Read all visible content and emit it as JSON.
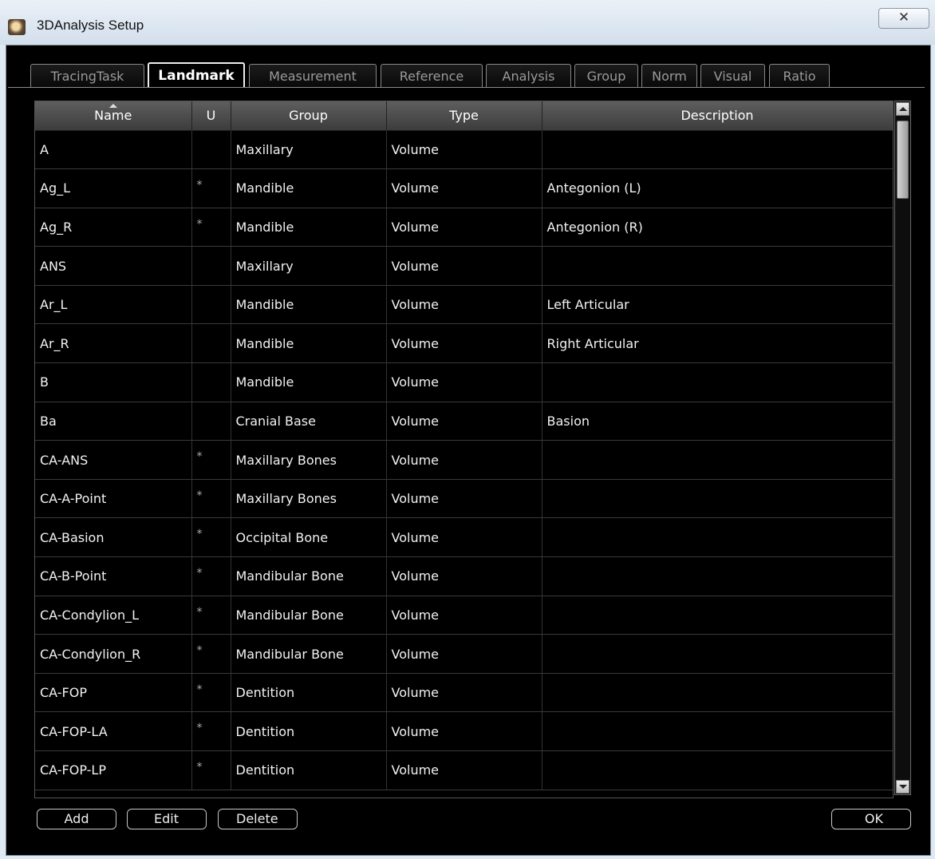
{
  "window": {
    "title": "3DAnalysis Setup",
    "close_glyph": "✕"
  },
  "tabs": [
    {
      "label": "TracingTask",
      "active": false
    },
    {
      "label": "Landmark",
      "active": true
    },
    {
      "label": "Measurement",
      "active": false
    },
    {
      "label": "Reference",
      "active": false
    },
    {
      "label": "Analysis",
      "active": false
    },
    {
      "label": "Group",
      "active": false
    },
    {
      "label": "Norm",
      "active": false
    },
    {
      "label": "Visual",
      "active": false
    },
    {
      "label": "Ratio",
      "active": false
    }
  ],
  "table": {
    "columns": [
      "Name",
      "U",
      "Group",
      "Type",
      "Description"
    ],
    "sort_column": "Name",
    "rows": [
      [
        "A",
        "",
        "Maxillary",
        "Volume",
        ""
      ],
      [
        "Ag_L",
        "*",
        "Mandible",
        "Volume",
        "Antegonion (L)"
      ],
      [
        "Ag_R",
        "*",
        "Mandible",
        "Volume",
        "Antegonion (R)"
      ],
      [
        "ANS",
        "",
        "Maxillary",
        "Volume",
        ""
      ],
      [
        "Ar_L",
        "",
        "Mandible",
        "Volume",
        "Left Articular"
      ],
      [
        "Ar_R",
        "",
        "Mandible",
        "Volume",
        "Right Articular"
      ],
      [
        "B",
        "",
        "Mandible",
        "Volume",
        ""
      ],
      [
        "Ba",
        "",
        "Cranial Base",
        "Volume",
        "Basion"
      ],
      [
        "CA-ANS",
        "*",
        "Maxillary Bones",
        "Volume",
        ""
      ],
      [
        "CA-A-Point",
        "*",
        "Maxillary Bones",
        "Volume",
        ""
      ],
      [
        "CA-Basion",
        "*",
        "Occipital Bone",
        "Volume",
        ""
      ],
      [
        "CA-B-Point",
        "*",
        "Mandibular Bone",
        "Volume",
        ""
      ],
      [
        "CA-Condylion_L",
        "*",
        "Mandibular Bone",
        "Volume",
        ""
      ],
      [
        "CA-Condylion_R",
        "*",
        "Mandibular Bone",
        "Volume",
        ""
      ],
      [
        "CA-FOP",
        "*",
        "Dentition",
        "Volume",
        ""
      ],
      [
        "CA-FOP-LA",
        "*",
        "Dentition",
        "Volume",
        ""
      ],
      [
        "CA-FOP-LP",
        "*",
        "Dentition",
        "Volume",
        ""
      ]
    ]
  },
  "buttons": {
    "add": "Add",
    "edit": "Edit",
    "delete": "Delete",
    "ok": "OK"
  }
}
